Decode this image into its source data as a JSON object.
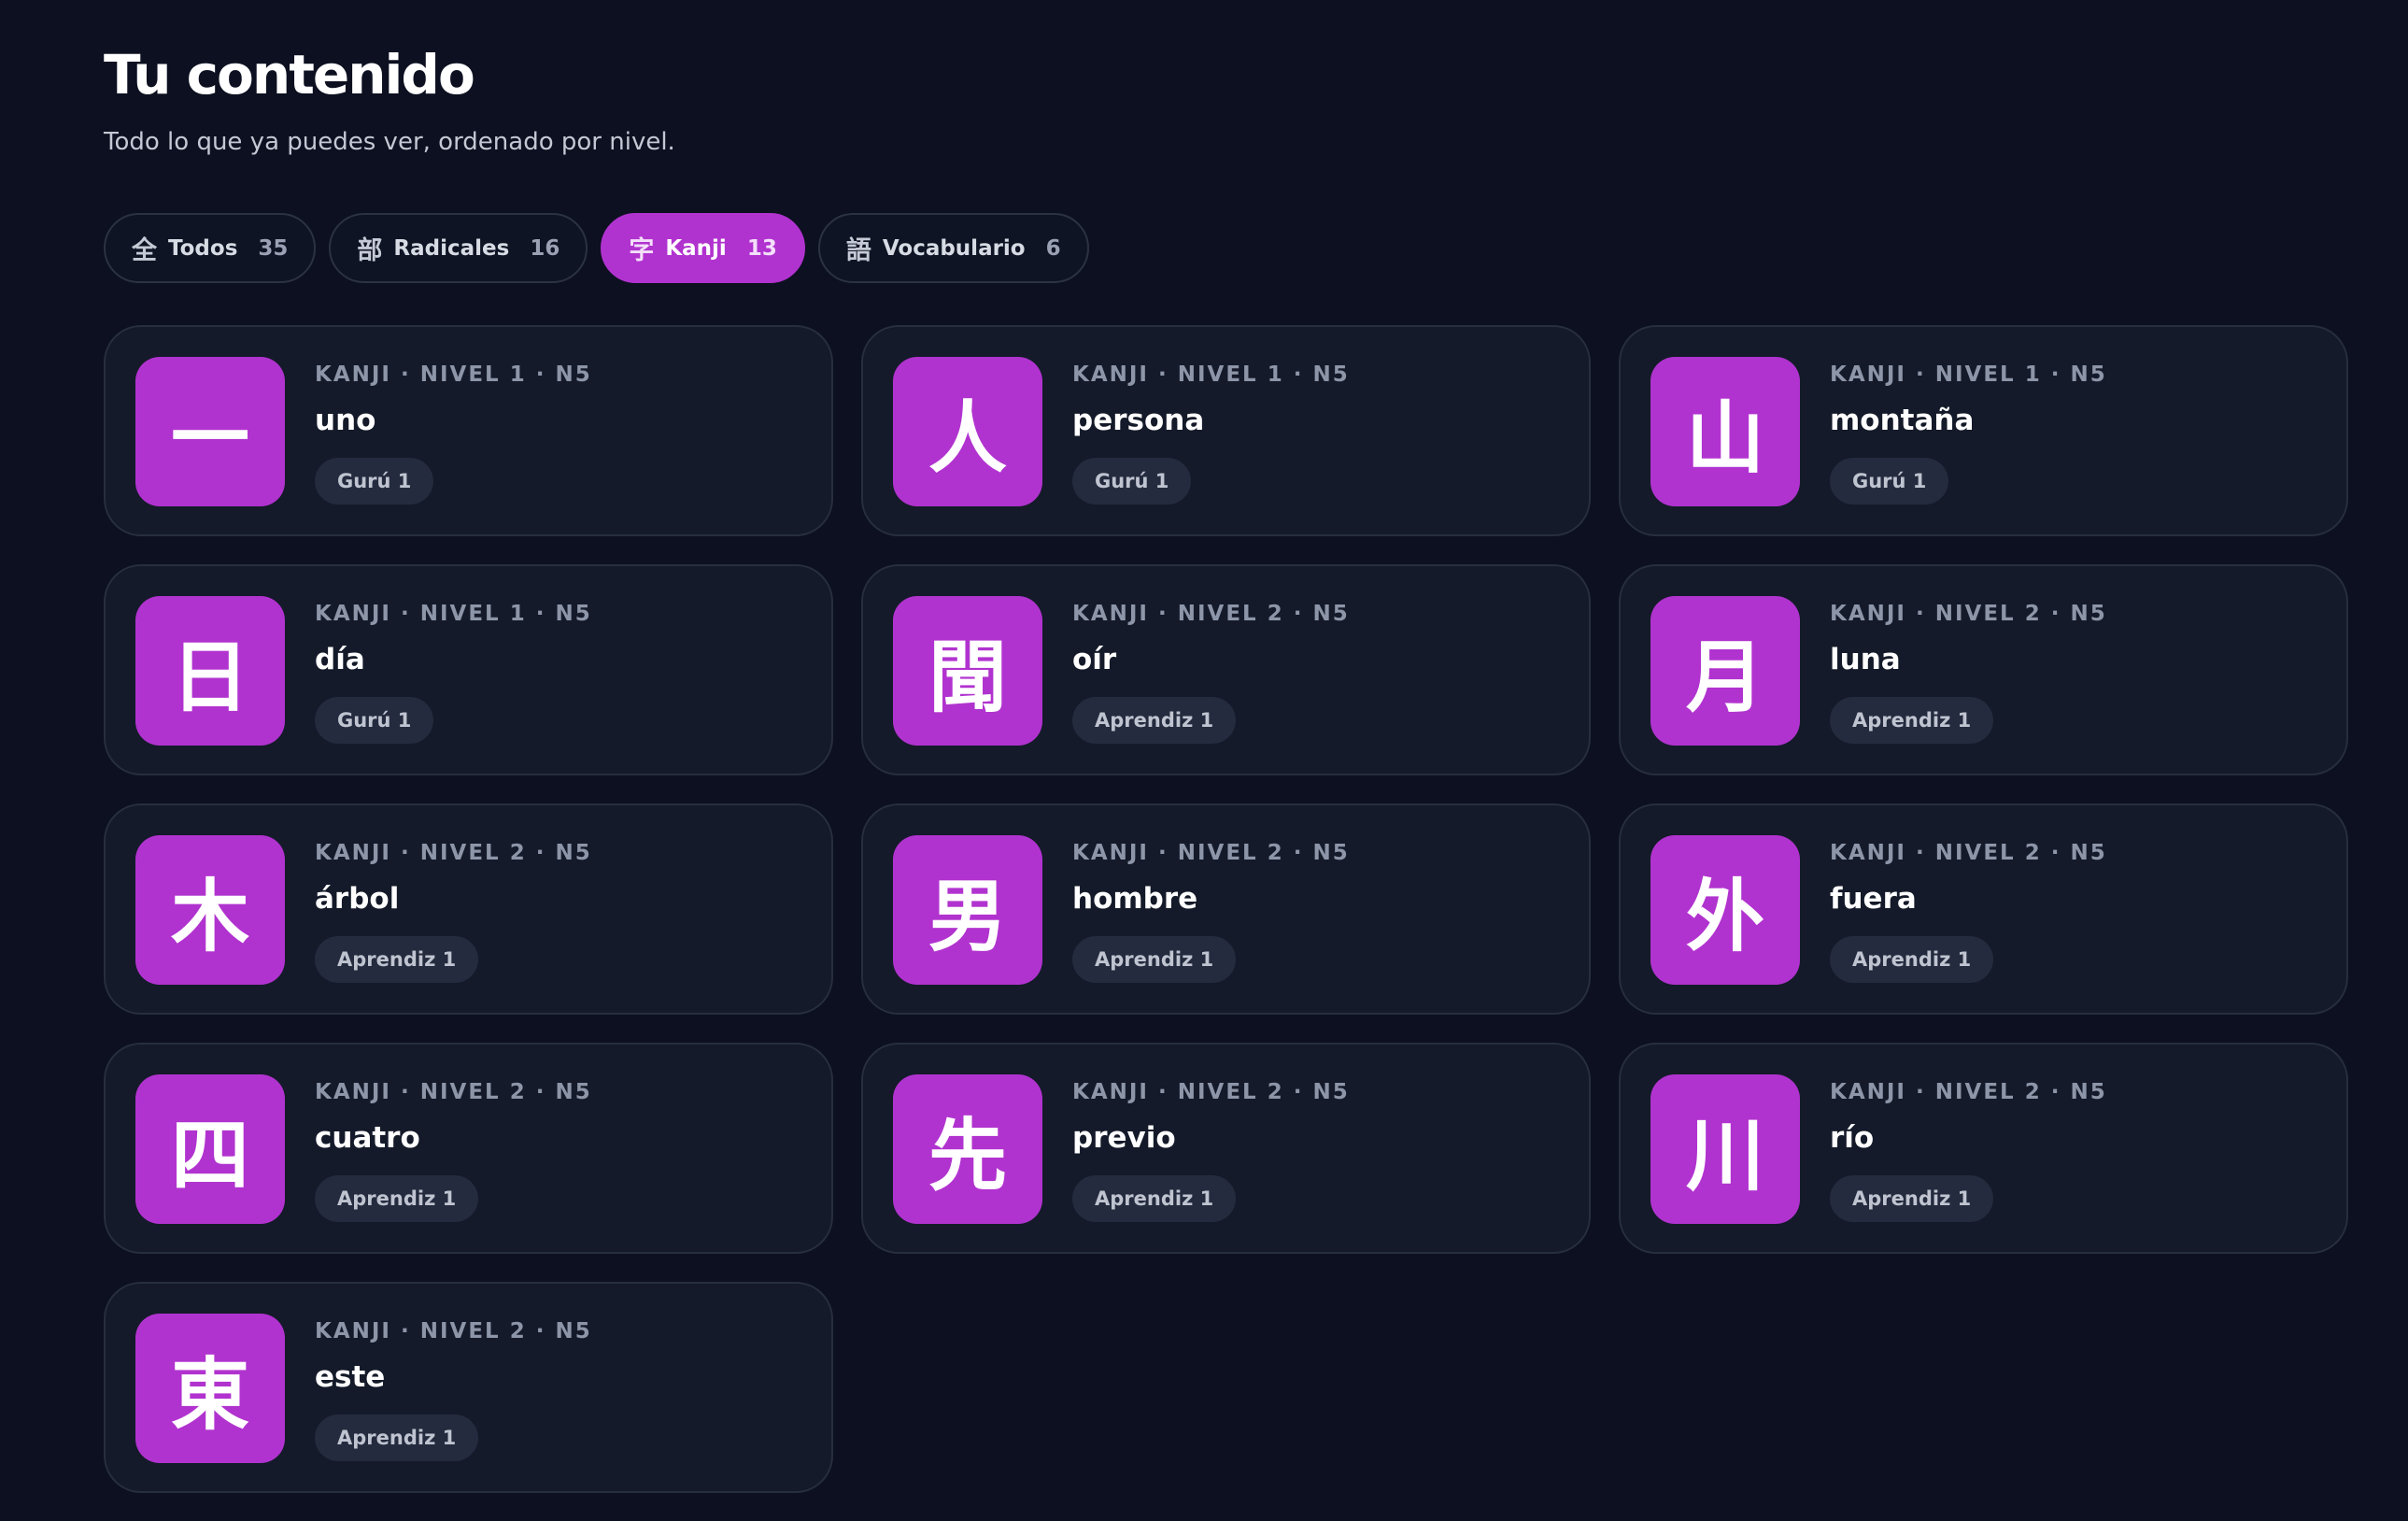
{
  "header": {
    "title": "Tu contenido",
    "subtitle": "Todo lo que ya puedes ver, ordenado por nivel."
  },
  "filters": [
    {
      "icon": "全",
      "label": "Todos",
      "count": "35",
      "active": false
    },
    {
      "icon": "部",
      "label": "Radicales",
      "count": "16",
      "active": false
    },
    {
      "icon": "字",
      "label": "Kanji",
      "count": "13",
      "active": true
    },
    {
      "icon": "語",
      "label": "Vocabulario",
      "count": "6",
      "active": false
    }
  ],
  "colors": {
    "accent": "#b133cf",
    "background": "#0c1020",
    "card": "#141a29"
  },
  "items": [
    {
      "glyph": "一",
      "meta": "KANJI · NIVEL 1 · N5",
      "meaning": "uno",
      "stage": "Gurú 1"
    },
    {
      "glyph": "人",
      "meta": "KANJI · NIVEL 1 · N5",
      "meaning": "persona",
      "stage": "Gurú 1"
    },
    {
      "glyph": "山",
      "meta": "KANJI · NIVEL 1 · N5",
      "meaning": "montaña",
      "stage": "Gurú 1"
    },
    {
      "glyph": "日",
      "meta": "KANJI · NIVEL 1 · N5",
      "meaning": "día",
      "stage": "Gurú 1"
    },
    {
      "glyph": "聞",
      "meta": "KANJI · NIVEL 2 · N5",
      "meaning": "oír",
      "stage": "Aprendiz 1"
    },
    {
      "glyph": "月",
      "meta": "KANJI · NIVEL 2 · N5",
      "meaning": "luna",
      "stage": "Aprendiz 1"
    },
    {
      "glyph": "木",
      "meta": "KANJI · NIVEL 2 · N5",
      "meaning": "árbol",
      "stage": "Aprendiz 1"
    },
    {
      "glyph": "男",
      "meta": "KANJI · NIVEL 2 · N5",
      "meaning": "hombre",
      "stage": "Aprendiz 1"
    },
    {
      "glyph": "外",
      "meta": "KANJI · NIVEL 2 · N5",
      "meaning": "fuera",
      "stage": "Aprendiz 1"
    },
    {
      "glyph": "四",
      "meta": "KANJI · NIVEL 2 · N5",
      "meaning": "cuatro",
      "stage": "Aprendiz 1"
    },
    {
      "glyph": "先",
      "meta": "KANJI · NIVEL 2 · N5",
      "meaning": "previo",
      "stage": "Aprendiz 1"
    },
    {
      "glyph": "川",
      "meta": "KANJI · NIVEL 2 · N5",
      "meaning": "río",
      "stage": "Aprendiz 1"
    },
    {
      "glyph": "東",
      "meta": "KANJI · NIVEL 2 · N5",
      "meaning": "este",
      "stage": "Aprendiz 1"
    }
  ]
}
